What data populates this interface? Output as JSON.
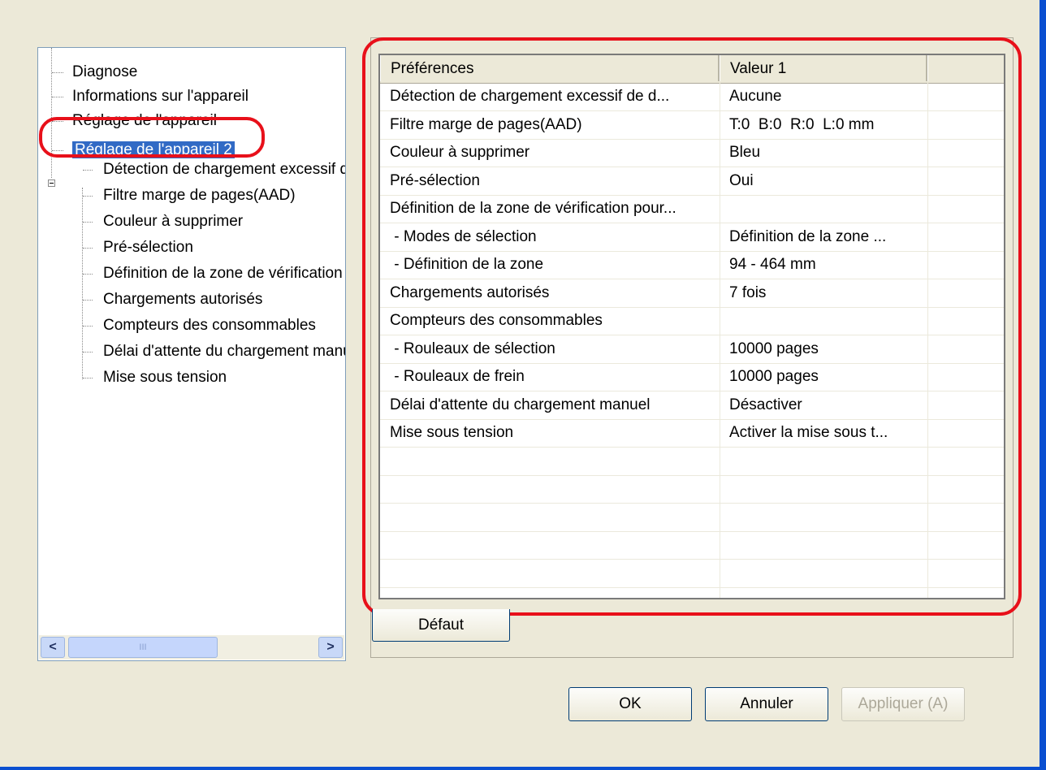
{
  "tree": {
    "items": [
      {
        "label": "Diagnose"
      },
      {
        "label": "Informations sur l'appareil"
      },
      {
        "label": "Réglage de l'appareil"
      },
      {
        "label": "Réglage de l'appareil 2"
      }
    ],
    "children": [
      {
        "label": "Détection de chargement excessif de documents"
      },
      {
        "label": "Filtre marge de pages(AAD)"
      },
      {
        "label": "Couleur à supprimer"
      },
      {
        "label": "Pré-sélection"
      },
      {
        "label": "Définition de la zone de vérification pour"
      },
      {
        "label": "Chargements autorisés"
      },
      {
        "label": "Compteurs des consommables"
      },
      {
        "label": "Délai d'attente du chargement manuel"
      },
      {
        "label": "Mise sous tension"
      }
    ],
    "scroll_left": "<",
    "scroll_right": ">",
    "scroll_grip": "III"
  },
  "grid": {
    "columns": [
      "Préférences",
      "Valeur 1"
    ],
    "rows": [
      {
        "pref": "Détection de chargement excessif de d...",
        "value": "Aucune"
      },
      {
        "pref": "Filtre marge de pages(AAD)",
        "value": "T:0  B:0  R:0  L:0 mm"
      },
      {
        "pref": "Couleur à supprimer",
        "value": "Bleu"
      },
      {
        "pref": "Pré-sélection",
        "value": "Oui"
      },
      {
        "pref": "Définition de la zone de vérification pour...",
        "value": ""
      },
      {
        "pref": " - Modes de sélection",
        "value": "Définition de la zone ..."
      },
      {
        "pref": " - Définition de la zone",
        "value": "94 - 464 mm"
      },
      {
        "pref": "Chargements autorisés",
        "value": "7 fois"
      },
      {
        "pref": "Compteurs des consommables",
        "value": ""
      },
      {
        "pref": " - Rouleaux de sélection",
        "value": "10000 pages"
      },
      {
        "pref": " - Rouleaux de frein",
        "value": "10000 pages"
      },
      {
        "pref": "Délai d'attente du chargement manuel",
        "value": "Désactiver"
      },
      {
        "pref": "Mise sous tension",
        "value": "Activer la mise sous t..."
      },
      {
        "pref": "",
        "value": ""
      },
      {
        "pref": "",
        "value": ""
      },
      {
        "pref": "",
        "value": ""
      },
      {
        "pref": "",
        "value": ""
      },
      {
        "pref": "",
        "value": ""
      }
    ]
  },
  "buttons": {
    "default": "Défaut",
    "ok": "OK",
    "cancel": "Annuler",
    "apply": "Appliquer (A)"
  },
  "colors": {
    "highlight": "#e8101a",
    "selection": "#316ac5"
  }
}
